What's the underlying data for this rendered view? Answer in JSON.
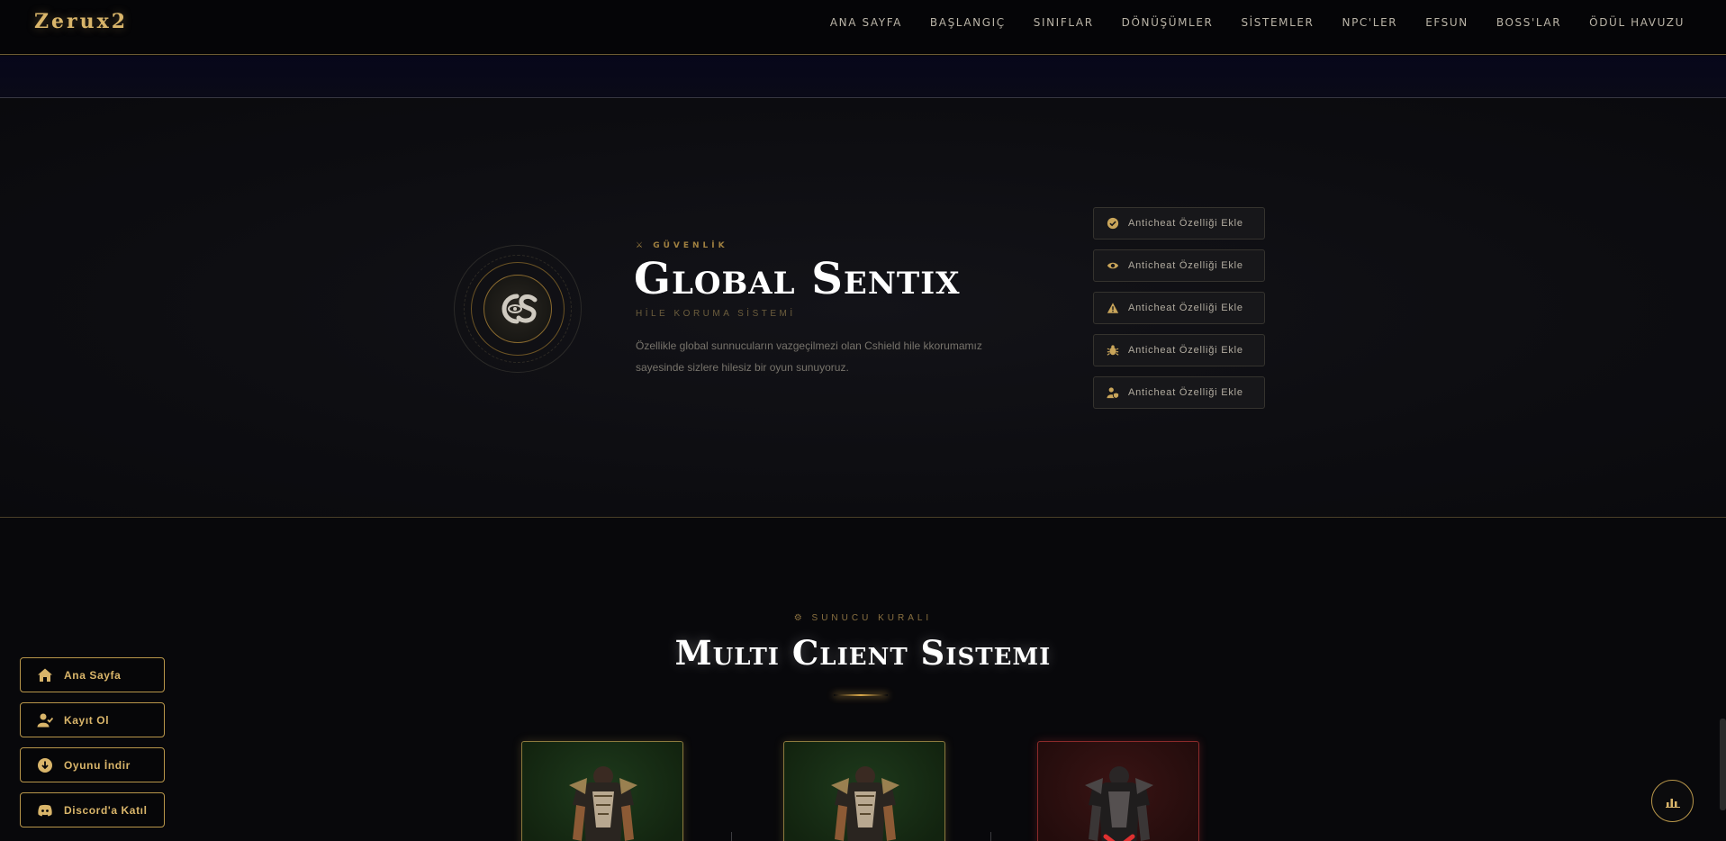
{
  "header": {
    "logo": "Zerux2",
    "nav": [
      "ANA SAYFA",
      "BAŞLANGIÇ",
      "SINIFLAR",
      "DÖNÜŞÜMLER",
      "SİSTEMLER",
      "NPC'LER",
      "EFSUN",
      "BOSS'LAR",
      "ÖDÜL HAVUZU"
    ]
  },
  "security": {
    "eyebrow": "⚔ GÜVENLİK",
    "title": "Global Sentix",
    "subtitle": "HİLE KORUMA SİSTEMİ",
    "description": "Özellikle global sunnucuların vazgeçilmezi olan Cshield hile kkorumamız sayesinde sizlere hilesiz bir oyun sunuyoruz.",
    "emblem_icon": "cs-shield-logo",
    "features": [
      {
        "label": "Anticheat Özelliği Ekle",
        "icon": "check-circle-icon"
      },
      {
        "label": "Anticheat Özelliği Ekle",
        "icon": "eye-icon"
      },
      {
        "label": "Anticheat Özelliği Ekle",
        "icon": "warning-icon"
      },
      {
        "label": "Anticheat Özelliği Ekle",
        "icon": "bug-icon"
      },
      {
        "label": "Anticheat Özelliği Ekle",
        "icon": "user-shield-icon"
      }
    ]
  },
  "rules": {
    "eyebrow": "⚙ SUNUCU KURALI",
    "title": "Multi Client Sistemi"
  },
  "floating": {
    "buttons": [
      {
        "label": "Ana Sayfa",
        "icon": "home-icon"
      },
      {
        "label": "Kayıt Ol",
        "icon": "user-check-icon"
      },
      {
        "label": "Oyunu İndir",
        "icon": "download-icon"
      },
      {
        "label": "Discord'a Katıl",
        "icon": "discord-icon"
      }
    ],
    "fab_icon": "stats-icon"
  },
  "colors": {
    "accent": "#d9b56a",
    "background": "#08080b",
    "allowed_card": "#1e3a1c",
    "denied_card": "#3a1414"
  }
}
